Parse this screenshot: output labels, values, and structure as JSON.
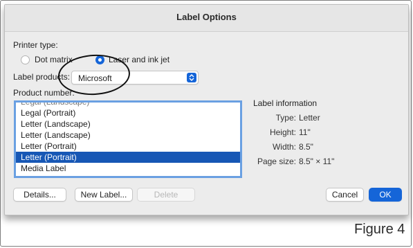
{
  "dialog": {
    "title": "Label Options",
    "printer_type": {
      "label": "Printer type:",
      "options": [
        {
          "label": "Dot matrix",
          "selected": false
        },
        {
          "label": "Laser and ink jet",
          "selected": true
        }
      ]
    },
    "label_products": {
      "label": "Label products:",
      "value": "Microsoft"
    },
    "product_number": {
      "label": "Product number:",
      "items": [
        {
          "label": "Legal (Landscape)",
          "selected": false
        },
        {
          "label": "Legal (Portrait)",
          "selected": false
        },
        {
          "label": "Letter (Landscape)",
          "selected": false
        },
        {
          "label": "Letter (Landscape)",
          "selected": false
        },
        {
          "label": "Letter (Portrait)",
          "selected": false
        },
        {
          "label": "Letter (Portrait)",
          "selected": true
        },
        {
          "label": "Media Label",
          "selected": false
        }
      ]
    },
    "label_information": {
      "heading": "Label information",
      "rows": [
        {
          "key": "Type:",
          "value": "Letter"
        },
        {
          "key": "Height:",
          "value": "11\""
        },
        {
          "key": "Width:",
          "value": "8.5\""
        },
        {
          "key": "Page size:",
          "value": "8.5\" × 11\""
        }
      ]
    },
    "buttons": {
      "details": "Details...",
      "new_label": "New Label...",
      "delete": "Delete",
      "cancel": "Cancel",
      "ok": "OK"
    }
  },
  "caption": "Figure 4",
  "colors": {
    "accent": "#1565d8",
    "selection": "#1757b5",
    "dialog_bg": "#ececec"
  }
}
